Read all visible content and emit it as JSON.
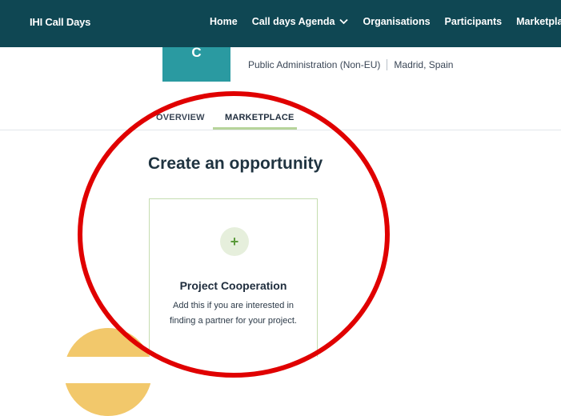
{
  "header": {
    "brand": "IHI Call Days",
    "nav": [
      {
        "label": "Home"
      },
      {
        "label": "Call days Agenda"
      },
      {
        "label": "Organisations"
      },
      {
        "label": "Participants"
      },
      {
        "label": "Marketplace"
      }
    ]
  },
  "organisation": {
    "logo_letter": "C",
    "type": "Public Administration (Non-EU)",
    "location": "Madrid, Spain"
  },
  "tabs": [
    {
      "label": "OVERVIEW"
    },
    {
      "label": "MARKETPLACE"
    }
  ],
  "main": {
    "section_title": "Create an opportunity",
    "card": {
      "icon": "plus-icon",
      "title": "Project Cooperation",
      "description_line1": "Add this if you are interested in",
      "description_line2": "finding a partner for your project."
    }
  },
  "colors": {
    "topbar": "#0f4753",
    "logo": "#2a9aa1",
    "tab_underline": "#b7d49b",
    "card_border": "#c5ddb0",
    "plus_bg": "#e6efdc",
    "annotation": "#e00000",
    "decoration": "#f2c86b"
  }
}
